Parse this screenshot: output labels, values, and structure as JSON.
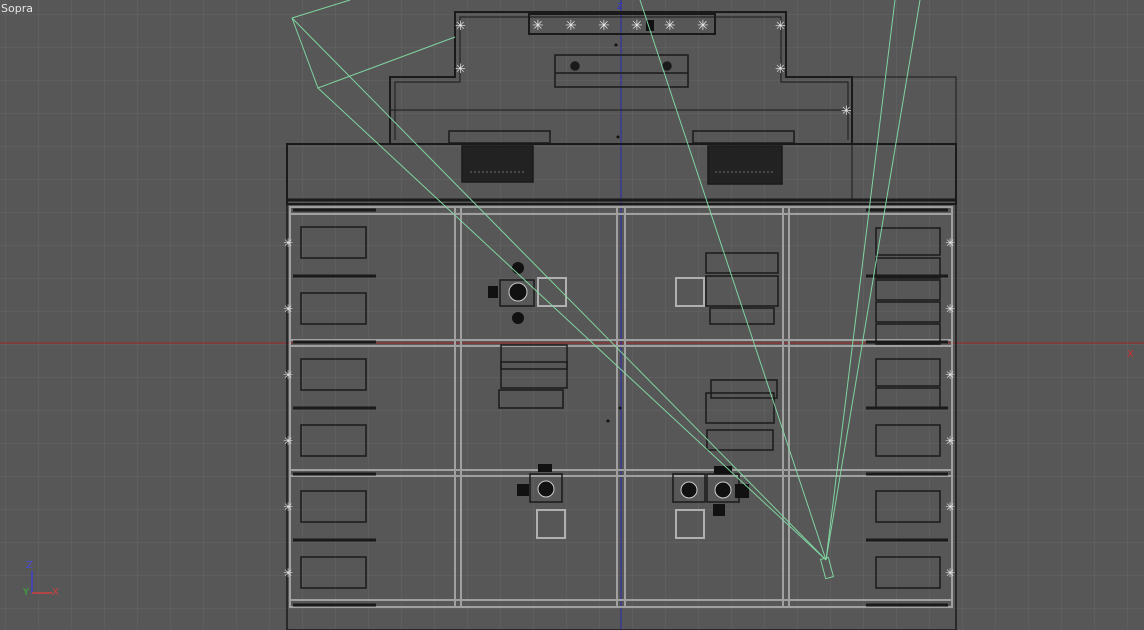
{
  "viewport": {
    "label": "Sopra",
    "axis_x": "X",
    "axis_z": "Z",
    "gizmo": {
      "z": "Z",
      "y": "Y",
      "x": "X"
    }
  },
  "colors": {
    "background": "#575757",
    "grid": "#646464",
    "geometry": "#1a1a1a",
    "frames": "#9a9a9a",
    "camera": "#7fd4a0",
    "x_axis": "#b02020",
    "z_axis": "#2020b0"
  }
}
